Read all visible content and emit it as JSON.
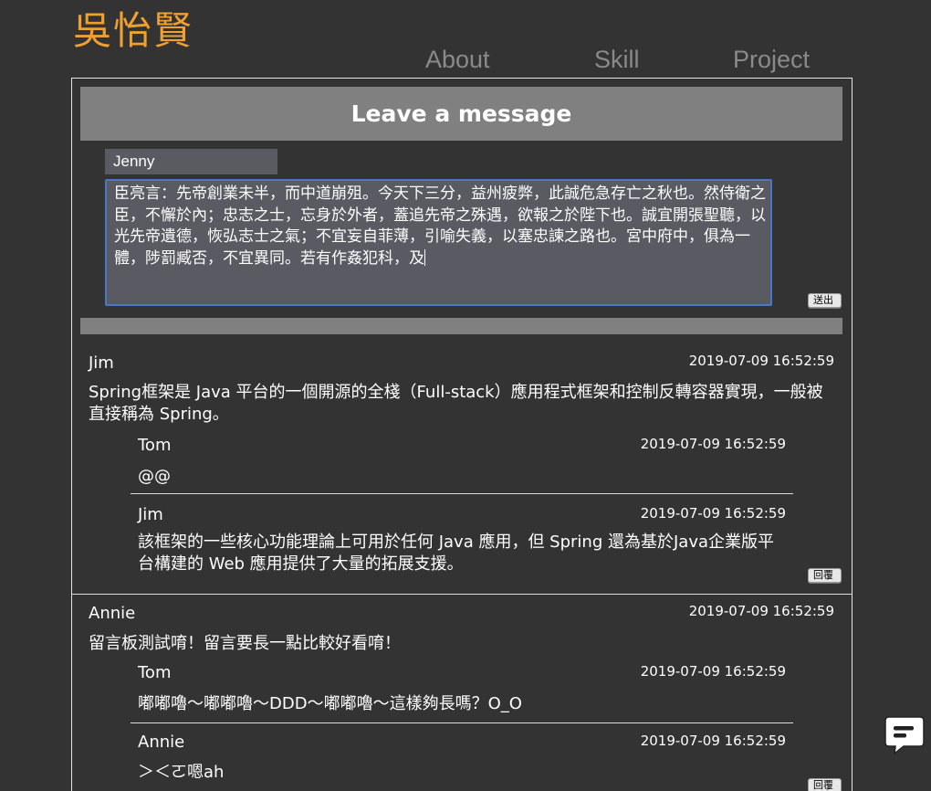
{
  "site": {
    "logo": "吳怡賢",
    "nav": [
      "About",
      "Skill",
      "Project"
    ]
  },
  "form": {
    "header": "Leave a message",
    "name_value": "Jenny",
    "message_value": "臣亮言：先帝創業未半，而中道崩殂。今天下三分，益州疲弊，此誠危急存亡之秋也。然侍衛之臣，不懈於內；忠志之士，忘身於外者，蓋追先帝之殊遇，欲報之於陛下也。誠宜開張聖聽，以光先帝遺德，恢弘志士之氣；不宜妄自菲薄，引喻失義，以塞忠諫之路也。宮中府中，俱為一體，陟罰臧否，不宜異同。若有作姦犯科，及",
    "send_label": "送出"
  },
  "comments": [
    {
      "name": "Jim",
      "time": "2019-07-09 16:52:59",
      "body": "Spring框架是 Java 平台的一個開源的全棧（Full-stack）應用程式框架和控制反轉容器實現，一般被直接稱為 Spring。",
      "replies": [
        {
          "name": "Tom",
          "time": "2019-07-09 16:52:59",
          "body": "@@"
        },
        {
          "name": "Jim",
          "time": "2019-07-09 16:52:59",
          "body": "該框架的一些核心功能理論上可用於任何 Java 應用，但 Spring 還為基於Java企業版平台構建的 Web 應用提供了大量的拓展支援。"
        }
      ],
      "reply_label": "回覆"
    },
    {
      "name": "Annie",
      "time": "2019-07-09 16:52:59",
      "body": "留言板測試唷！留言要長一點比較好看唷！",
      "replies": [
        {
          "name": "Tom",
          "time": "2019-07-09 16:52:59",
          "body": "嘟嘟嚕～嘟嘟嚕～DDD～嘟嘟嚕～這樣夠長嗎？O_O"
        },
        {
          "name": "Annie",
          "time": "2019-07-09 16:52:59",
          "body": "＞＜ㄛ嗯ah"
        }
      ],
      "reply_label": "回覆"
    }
  ],
  "chat_fab": {
    "icon": "chat-bubble-icon"
  }
}
